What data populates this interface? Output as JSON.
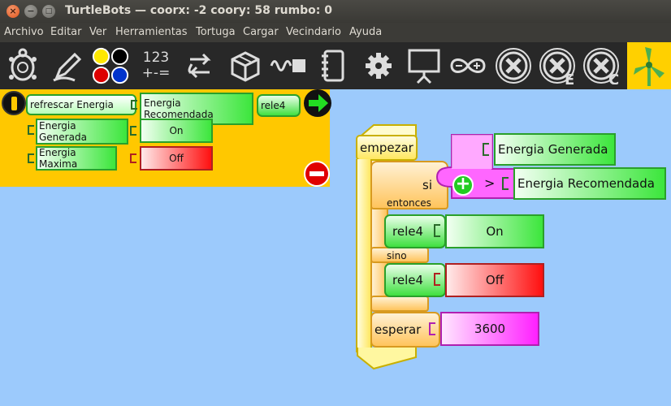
{
  "window": {
    "title": "TurtleBots — coorx: -2 coory: 58 rumbo: 0",
    "close_glyph": "×",
    "minimize_glyph": "−",
    "maximize_glyph": "□"
  },
  "menu": [
    "Archivo",
    "Editar",
    "Ver",
    "Herramientas",
    "Tortuga",
    "Cargar",
    "Vecindario",
    "Ayuda"
  ],
  "toolbar": {
    "numbers_label_top": "123",
    "numbers_label_bottom": "+-=",
    "swatch_colors": [
      "#ffe800",
      "#000000",
      "#dd0000",
      "#0033cc"
    ],
    "active_tab_color": "#ffd000",
    "letter_e": "E",
    "letter_c": "C"
  },
  "palette": {
    "blocks": {
      "refresh": "refrescar Energia",
      "recommended": "Energia Recomendada",
      "relay": "rele4",
      "generated": "Energia Generada",
      "maximum": "Energia Maxima",
      "on": "On",
      "off": "Off"
    }
  },
  "canvas": {
    "start": "empezar",
    "if": "si",
    "then": "entonces",
    "else": "sino",
    "left_operand": "Energia Generada",
    "operator": ">",
    "right_operand": "Energia Recomendada",
    "relay_then": "rele4",
    "value_on": "On",
    "relay_else": "rele4",
    "value_off": "Off",
    "wait": "esperar",
    "wait_value": "3600"
  }
}
